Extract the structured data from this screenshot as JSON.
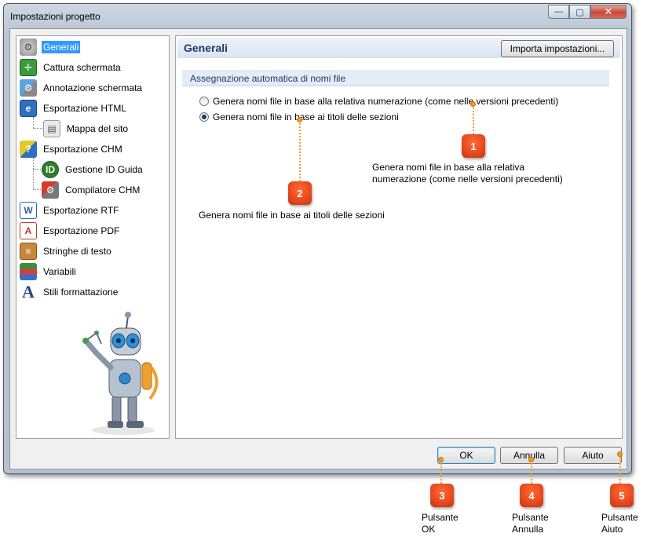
{
  "window": {
    "title": "Impostazioni progetto",
    "minimize_glyph": "—",
    "maximize_glyph": "▢",
    "close_glyph": "✕"
  },
  "tree": {
    "items": [
      {
        "label": "Generali",
        "icon": "gear-icon",
        "selected": true
      },
      {
        "label": "Cattura schermata",
        "icon": "screen-capture-icon"
      },
      {
        "label": "Annotazione schermata",
        "icon": "annotation-icon"
      },
      {
        "label": "Esportazione HTML",
        "icon": "html-export-icon"
      },
      {
        "label": "Mappa del sito",
        "icon": "sitemap-icon"
      },
      {
        "label": "Esportazione CHM",
        "icon": "chm-export-icon"
      },
      {
        "label": "Gestione ID Guida",
        "icon": "help-id-icon"
      },
      {
        "label": "Compilatore CHM",
        "icon": "chm-compiler-icon"
      },
      {
        "label": "Esportazione RTF",
        "icon": "rtf-export-icon"
      },
      {
        "label": "Esportazione PDF",
        "icon": "pdf-export-icon"
      },
      {
        "label": "Stringhe di testo",
        "icon": "text-strings-icon"
      },
      {
        "label": "Variabili",
        "icon": "variables-icon"
      },
      {
        "label": "Stili formattazione",
        "icon": "styles-icon"
      }
    ]
  },
  "panel": {
    "title": "Generali",
    "import_button": "Importa impostazioni...",
    "group_title": "Assegnazione automatica di nomi file",
    "options": [
      {
        "label": "Genera nomi file in base alla relativa numerazione (come nelle versioni precedenti)",
        "checked": false
      },
      {
        "label": "Genera nomi file in base ai titoli delle sezioni",
        "checked": true
      }
    ]
  },
  "buttons": {
    "ok": "OK",
    "cancel": "Annulla",
    "help": "Aiuto"
  },
  "annotations": {
    "c1": {
      "num": "1",
      "text_line1": "Genera nomi file in base alla relativa",
      "text_line2": "numerazione (come nelle versioni precedenti)"
    },
    "c2": {
      "num": "2",
      "text": "Genera nomi file in base ai titoli delle sezioni"
    },
    "c3": {
      "num": "3",
      "text_line1": "Pulsante",
      "text_line2": "OK"
    },
    "c4": {
      "num": "4",
      "text_line1": "Pulsante",
      "text_line2": "Annulla"
    },
    "c5": {
      "num": "5",
      "text_line1": "Pulsante",
      "text_line2": "Aiuto"
    }
  },
  "colors": {
    "selection": "#3399ff",
    "callout": "#e0421a",
    "callout_line": "#f0a030"
  }
}
